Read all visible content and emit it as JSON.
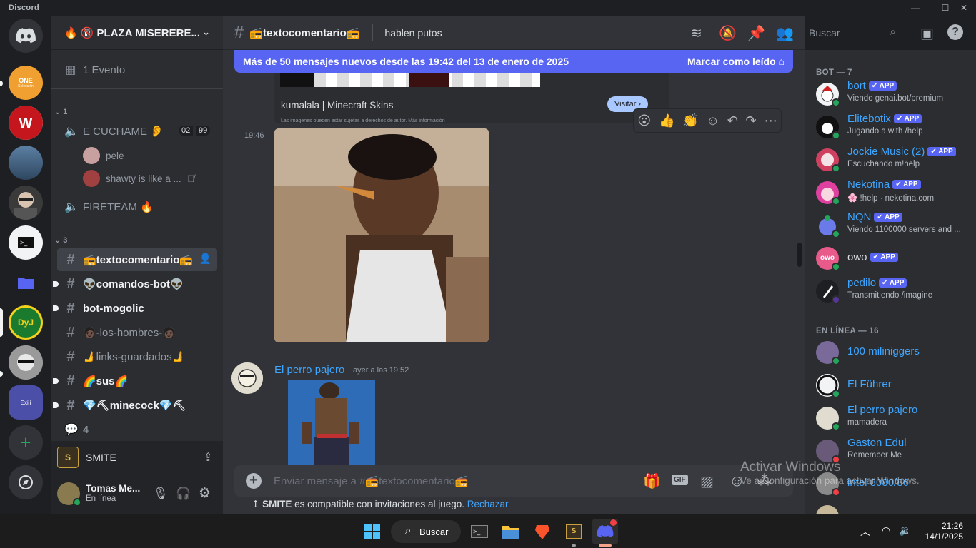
{
  "window": {
    "app_name": "Discord"
  },
  "guilds": {
    "one_label": "ONE",
    "one_sub": "Selección",
    "exili_label": "Exili"
  },
  "server": {
    "name": "🔞 PLAZA MISERERE..."
  },
  "sidebar": {
    "event": "1 Evento",
    "cat1": "1",
    "voice1": "E CUCHAME 👂",
    "voice1_count_a": "02",
    "voice1_count_b": "99",
    "voice_users": [
      "pele",
      "shawty is like a ..."
    ],
    "voice2": "FIRETEAM 🔥",
    "cat3": "3",
    "channels": [
      "📻textocomentario📻",
      "👽comandos-bot👽",
      "bot-mogolic",
      "🧑🏿-los-hombres-🧑🏿",
      "🫸links-guardados🫸",
      "🌈sus🌈",
      "💎⛏minecock💎⛏"
    ],
    "forum": "4"
  },
  "activity": {
    "game": "SMITE"
  },
  "user": {
    "name": "Tomas Me...",
    "status": "En línea"
  },
  "channel": {
    "name": "📻textocomentario📻",
    "topic": "hablen putos"
  },
  "search": {
    "placeholder": "Buscar"
  },
  "newbar": {
    "text": "Más de 50 mensajes nuevos desde las 19:42 del 13 de enero de 2025",
    "mark": "Marcar como leído"
  },
  "embed": {
    "site": "kumalala | Minecraft Skins",
    "button": "Visitar ›",
    "note": "Las imágenes pueden estar sujetas a derechos de autor. Más información"
  },
  "messages": [
    {
      "time": "19:46"
    },
    {
      "author": "El perro pajero",
      "time": "ayer a las 19:52"
    }
  ],
  "composer": {
    "placeholder": "Enviar mensaje a #📻textocomentario📻",
    "gif": "GIF"
  },
  "compat": {
    "game": "SMITE",
    "text": " es compatible con invitaciones al juego. ",
    "reject": "Rechazar"
  },
  "members": {
    "bot_header": "BOT — 7",
    "bots": [
      {
        "name": "bort",
        "status": "Viendo genai.bot/premium"
      },
      {
        "name": "Elitebotix",
        "status": "Jugando a with /help"
      },
      {
        "name": "Jockie Music (2)",
        "status": "Escuchando m!help"
      },
      {
        "name": "Nekotina",
        "status": "🌸 !help · nekotina.com"
      },
      {
        "name": "NQN",
        "status": "Viendo 1100000 servers and ..."
      },
      {
        "name": "owo",
        "status": ""
      },
      {
        "name": "pedilo",
        "status": "Transmitiendo /imagine"
      }
    ],
    "app_badge": "✔ APP",
    "online_header": "EN LÍNEA — 16",
    "online": [
      {
        "name": "100 miliniggers",
        "status": ""
      },
      {
        "name": "El Führer",
        "status": ""
      },
      {
        "name": "El perro pajero",
        "status": "mamadera"
      },
      {
        "name": "Gaston Edul",
        "status": "Remember Me"
      },
      {
        "name": "intel 8080/86",
        "status": ""
      }
    ]
  },
  "watermark": {
    "title": "Activar Windows",
    "sub": "Ve a Configuración para activar Windows."
  },
  "taskbar": {
    "search": "Buscar",
    "time": "21:26",
    "date": "14/1/2025"
  },
  "colors": {
    "accent": "#5865f2",
    "link": "#3ea6ff",
    "online": "#23a55a",
    "dnd": "#f23f43"
  }
}
